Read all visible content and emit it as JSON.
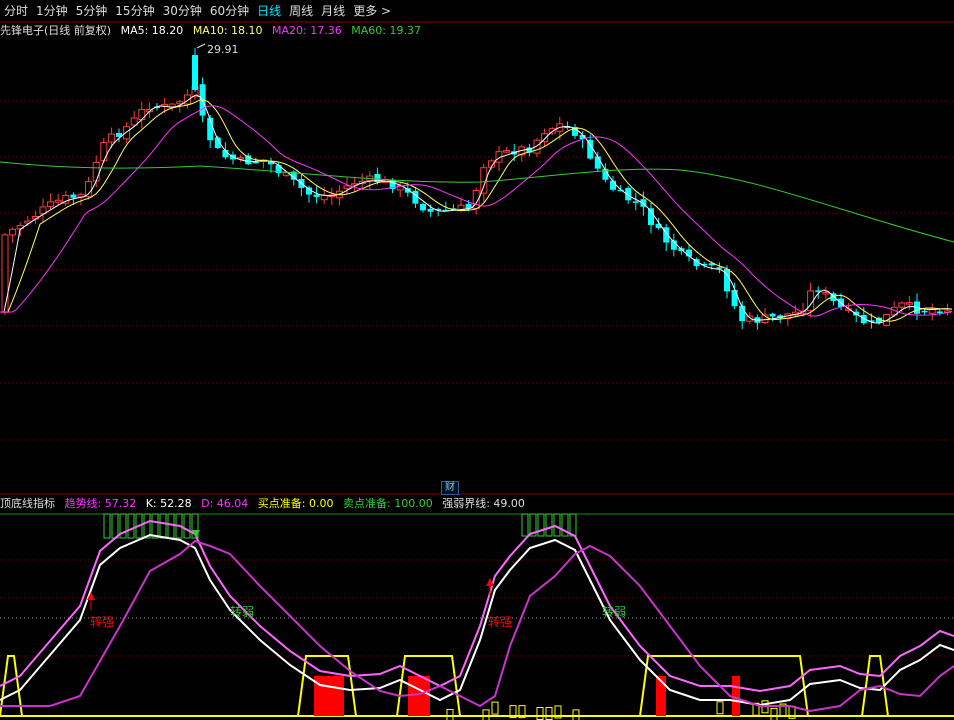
{
  "tabs": [
    {
      "label": "分时",
      "active": false
    },
    {
      "label": "1分钟",
      "active": false
    },
    {
      "label": "5分钟",
      "active": false
    },
    {
      "label": "15分钟",
      "active": false
    },
    {
      "label": "30分钟",
      "active": false
    },
    {
      "label": "60分钟",
      "active": false
    },
    {
      "label": "日线",
      "active": true
    },
    {
      "label": "周线",
      "active": false
    },
    {
      "label": "月线",
      "active": false
    },
    {
      "label": "更多 >",
      "active": false
    }
  ],
  "main": {
    "title": "先锋电子(日线 前复权)",
    "ma5": "MA5: 18.20",
    "ma10": "MA10: 18.10",
    "ma20": "MA20: 17.36",
    "ma60": "MA60: 19.37",
    "high_label": "29.91"
  },
  "cai_label": "财",
  "indicator": {
    "name": "顶底线指标",
    "trend": "趋势线: 57.32",
    "k": "K: 52.28",
    "d": "D: 46.04",
    "buy": "买点准备: 0.00",
    "sell": "卖点准备: 100.00",
    "boundary": "强弱界线: 49.00",
    "label_strong": "转强",
    "label_weak": "转弱"
  },
  "colors": {
    "up": "#ff3b3b",
    "down": "#00ffff",
    "ma5": "#ffffff",
    "ma10": "#ffff66",
    "ma20": "#ff33ff",
    "ma60": "#33cc33",
    "grid": "#7a0000",
    "yellow": "#ffff00",
    "bar_red": "#ff0000"
  },
  "chart_data": {
    "type": "candlestick",
    "annotated_high": 29.91,
    "ma_values": {
      "MA5": 18.2,
      "MA10": 18.1,
      "MA20": 17.36,
      "MA60": 19.37
    },
    "indicator_values": {
      "趋势线": 57.32,
      "K": 52.28,
      "D": 46.04,
      "买点准备": 0.0,
      "卖点准备": 100.0,
      "强弱界线": 49.0
    }
  }
}
